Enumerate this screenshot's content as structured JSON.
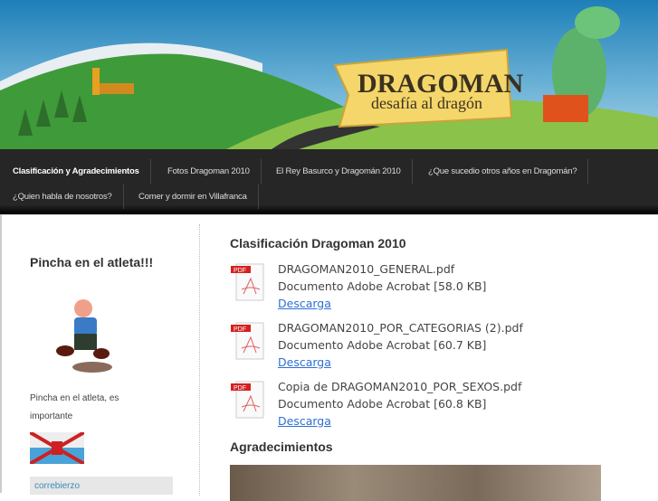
{
  "banner": {
    "title": "DRAGOMAN",
    "subtitle": "desafía al dragón"
  },
  "nav": {
    "items": [
      {
        "label": "Clasificación y Agradecimientos",
        "active": true
      },
      {
        "label": "Fotos Dragoman 2010"
      },
      {
        "label": "El Rey Basurco y Dragomán 2010"
      },
      {
        "label": "¿Que sucedio otros años en Dragomán?"
      },
      {
        "label": "¿Quien habla de nosotros?"
      },
      {
        "label": "Comer y dormir en Villafranca"
      }
    ]
  },
  "sidebar": {
    "title": "Pincha en el atleta!!!",
    "text": "Pincha en el atleta, es importante",
    "banner_text": "correbierzo"
  },
  "main": {
    "title": "Clasificación Dragoman 2010",
    "files": [
      {
        "name": "DRAGOMAN2010_GENERAL.pdf",
        "desc": "Documento Adobe Acrobat [58.0 KB]",
        "link": "Descarga"
      },
      {
        "name": "DRAGOMAN2010_POR_CATEGORIAS (2).pdf",
        "desc": "Documento Adobe Acrobat [60.7 KB]",
        "link": "Descarga"
      },
      {
        "name": "Copia de DRAGOMAN2010_POR_SEXOS.pdf",
        "desc": "Documento Adobe Acrobat [60.8 KB]",
        "link": "Descarga"
      }
    ],
    "subtitle": "Agradecimientos",
    "pdf_badge": "PDF"
  }
}
